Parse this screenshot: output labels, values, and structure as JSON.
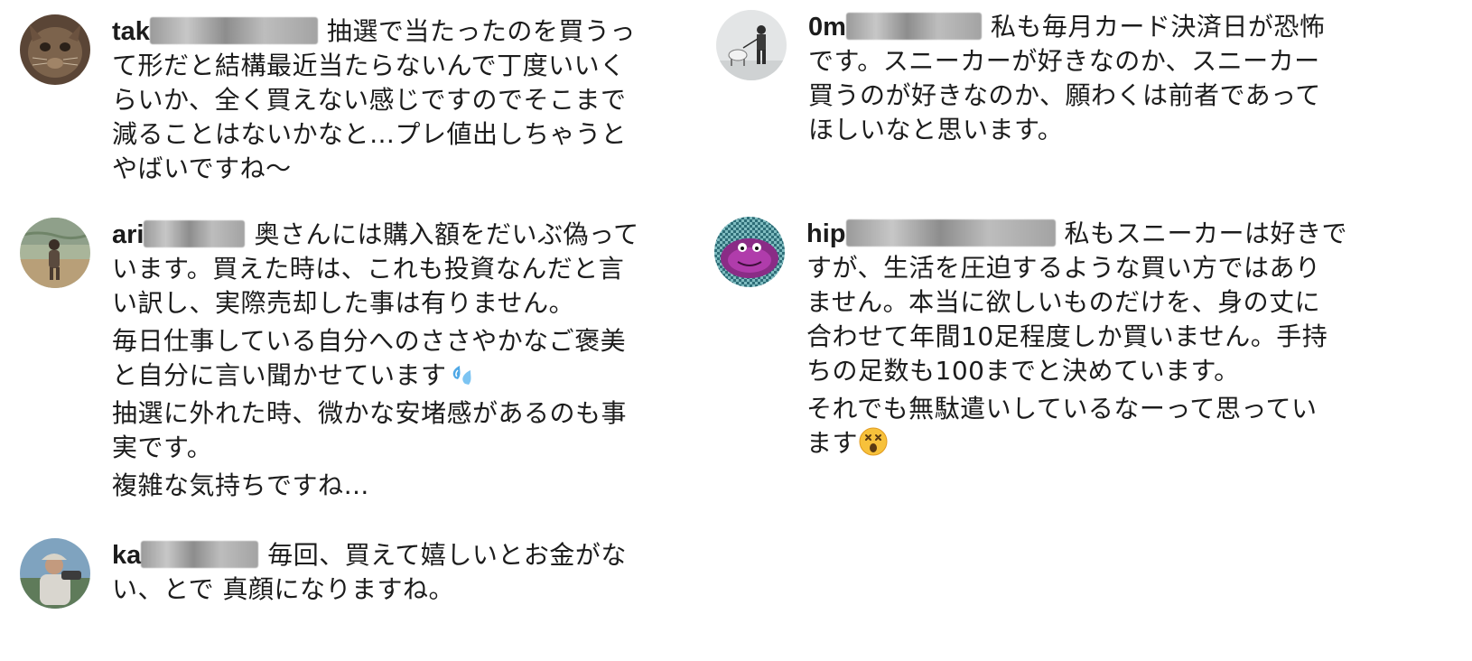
{
  "comments": {
    "tak": {
      "username": "tak",
      "lines": [
        "抽選で当たったのを買うっ",
        "て形だと結構最近当たらないんで丁度いいく",
        "らいか、全く買えない感じですのでそこまで",
        "減ることはないかなと…プレ値出しちゃうと",
        "やばいですね〜"
      ]
    },
    "ari": {
      "username": "ari",
      "lines": [
        "奥さんには購入額をだいぶ偽って",
        "います。買えた時は、これも投資なんだと言",
        "い訳し、実際売却した事は有りません。",
        "毎日仕事している自分へのささやかなご褒美",
        "と自分に言い聞かせています",
        "抽選に外れた時、微かな安堵感があるのも事",
        "実です。",
        "複雑な気持ちですね…"
      ]
    },
    "ka": {
      "username": "ka",
      "lines": [
        "毎回、買えて嬉しいとお金がな",
        "い、とで 真顔になりますね。"
      ]
    },
    "om": {
      "username": "0m",
      "lines": [
        "私も毎月カード決済日が恐怖",
        "です。スニーカーが好きなのか、スニーカー",
        "買うのが好きなのか、願わくは前者であって",
        "ほしいなと思います。"
      ]
    },
    "hip": {
      "username": "hip",
      "lines": [
        "私もスニーカーは好きで",
        "すが、生活を圧迫するような買い方ではあり",
        "ません。本当に欲しいものだけを、身の丈に",
        "合わせて年間10足程度しか買いません。手持",
        "ちの足数も100までと決めています。",
        "それでも無駄遣いしているなーって思ってい",
        "ます"
      ]
    }
  },
  "icons": {
    "sweat_droplets": "sweat-droplets-icon",
    "dizzy_face": "dizzy-face-icon"
  }
}
